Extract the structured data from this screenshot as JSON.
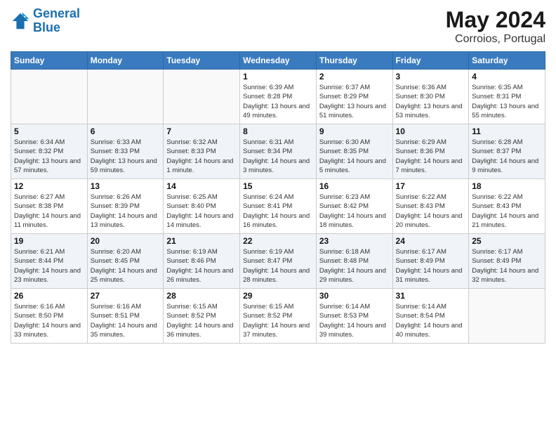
{
  "header": {
    "logo_general": "General",
    "logo_blue": "Blue",
    "title": "May 2024",
    "subtitle": "Corroios, Portugal"
  },
  "days_of_week": [
    "Sunday",
    "Monday",
    "Tuesday",
    "Wednesday",
    "Thursday",
    "Friday",
    "Saturday"
  ],
  "weeks": [
    [
      {
        "day": "",
        "sunrise": "",
        "sunset": "",
        "daylight": ""
      },
      {
        "day": "",
        "sunrise": "",
        "sunset": "",
        "daylight": ""
      },
      {
        "day": "",
        "sunrise": "",
        "sunset": "",
        "daylight": ""
      },
      {
        "day": "1",
        "sunrise": "Sunrise: 6:39 AM",
        "sunset": "Sunset: 8:28 PM",
        "daylight": "Daylight: 13 hours and 49 minutes."
      },
      {
        "day": "2",
        "sunrise": "Sunrise: 6:37 AM",
        "sunset": "Sunset: 8:29 PM",
        "daylight": "Daylight: 13 hours and 51 minutes."
      },
      {
        "day": "3",
        "sunrise": "Sunrise: 6:36 AM",
        "sunset": "Sunset: 8:30 PM",
        "daylight": "Daylight: 13 hours and 53 minutes."
      },
      {
        "day": "4",
        "sunrise": "Sunrise: 6:35 AM",
        "sunset": "Sunset: 8:31 PM",
        "daylight": "Daylight: 13 hours and 55 minutes."
      }
    ],
    [
      {
        "day": "5",
        "sunrise": "Sunrise: 6:34 AM",
        "sunset": "Sunset: 8:32 PM",
        "daylight": "Daylight: 13 hours and 57 minutes."
      },
      {
        "day": "6",
        "sunrise": "Sunrise: 6:33 AM",
        "sunset": "Sunset: 8:33 PM",
        "daylight": "Daylight: 13 hours and 59 minutes."
      },
      {
        "day": "7",
        "sunrise": "Sunrise: 6:32 AM",
        "sunset": "Sunset: 8:33 PM",
        "daylight": "Daylight: 14 hours and 1 minute."
      },
      {
        "day": "8",
        "sunrise": "Sunrise: 6:31 AM",
        "sunset": "Sunset: 8:34 PM",
        "daylight": "Daylight: 14 hours and 3 minutes."
      },
      {
        "day": "9",
        "sunrise": "Sunrise: 6:30 AM",
        "sunset": "Sunset: 8:35 PM",
        "daylight": "Daylight: 14 hours and 5 minutes."
      },
      {
        "day": "10",
        "sunrise": "Sunrise: 6:29 AM",
        "sunset": "Sunset: 8:36 PM",
        "daylight": "Daylight: 14 hours and 7 minutes."
      },
      {
        "day": "11",
        "sunrise": "Sunrise: 6:28 AM",
        "sunset": "Sunset: 8:37 PM",
        "daylight": "Daylight: 14 hours and 9 minutes."
      }
    ],
    [
      {
        "day": "12",
        "sunrise": "Sunrise: 6:27 AM",
        "sunset": "Sunset: 8:38 PM",
        "daylight": "Daylight: 14 hours and 11 minutes."
      },
      {
        "day": "13",
        "sunrise": "Sunrise: 6:26 AM",
        "sunset": "Sunset: 8:39 PM",
        "daylight": "Daylight: 14 hours and 13 minutes."
      },
      {
        "day": "14",
        "sunrise": "Sunrise: 6:25 AM",
        "sunset": "Sunset: 8:40 PM",
        "daylight": "Daylight: 14 hours and 14 minutes."
      },
      {
        "day": "15",
        "sunrise": "Sunrise: 6:24 AM",
        "sunset": "Sunset: 8:41 PM",
        "daylight": "Daylight: 14 hours and 16 minutes."
      },
      {
        "day": "16",
        "sunrise": "Sunrise: 6:23 AM",
        "sunset": "Sunset: 8:42 PM",
        "daylight": "Daylight: 14 hours and 18 minutes."
      },
      {
        "day": "17",
        "sunrise": "Sunrise: 6:22 AM",
        "sunset": "Sunset: 8:43 PM",
        "daylight": "Daylight: 14 hours and 20 minutes."
      },
      {
        "day": "18",
        "sunrise": "Sunrise: 6:22 AM",
        "sunset": "Sunset: 8:43 PM",
        "daylight": "Daylight: 14 hours and 21 minutes."
      }
    ],
    [
      {
        "day": "19",
        "sunrise": "Sunrise: 6:21 AM",
        "sunset": "Sunset: 8:44 PM",
        "daylight": "Daylight: 14 hours and 23 minutes."
      },
      {
        "day": "20",
        "sunrise": "Sunrise: 6:20 AM",
        "sunset": "Sunset: 8:45 PM",
        "daylight": "Daylight: 14 hours and 25 minutes."
      },
      {
        "day": "21",
        "sunrise": "Sunrise: 6:19 AM",
        "sunset": "Sunset: 8:46 PM",
        "daylight": "Daylight: 14 hours and 26 minutes."
      },
      {
        "day": "22",
        "sunrise": "Sunrise: 6:19 AM",
        "sunset": "Sunset: 8:47 PM",
        "daylight": "Daylight: 14 hours and 28 minutes."
      },
      {
        "day": "23",
        "sunrise": "Sunrise: 6:18 AM",
        "sunset": "Sunset: 8:48 PM",
        "daylight": "Daylight: 14 hours and 29 minutes."
      },
      {
        "day": "24",
        "sunrise": "Sunrise: 6:17 AM",
        "sunset": "Sunset: 8:49 PM",
        "daylight": "Daylight: 14 hours and 31 minutes."
      },
      {
        "day": "25",
        "sunrise": "Sunrise: 6:17 AM",
        "sunset": "Sunset: 8:49 PM",
        "daylight": "Daylight: 14 hours and 32 minutes."
      }
    ],
    [
      {
        "day": "26",
        "sunrise": "Sunrise: 6:16 AM",
        "sunset": "Sunset: 8:50 PM",
        "daylight": "Daylight: 14 hours and 33 minutes."
      },
      {
        "day": "27",
        "sunrise": "Sunrise: 6:16 AM",
        "sunset": "Sunset: 8:51 PM",
        "daylight": "Daylight: 14 hours and 35 minutes."
      },
      {
        "day": "28",
        "sunrise": "Sunrise: 6:15 AM",
        "sunset": "Sunset: 8:52 PM",
        "daylight": "Daylight: 14 hours and 36 minutes."
      },
      {
        "day": "29",
        "sunrise": "Sunrise: 6:15 AM",
        "sunset": "Sunset: 8:52 PM",
        "daylight": "Daylight: 14 hours and 37 minutes."
      },
      {
        "day": "30",
        "sunrise": "Sunrise: 6:14 AM",
        "sunset": "Sunset: 8:53 PM",
        "daylight": "Daylight: 14 hours and 39 minutes."
      },
      {
        "day": "31",
        "sunrise": "Sunrise: 6:14 AM",
        "sunset": "Sunset: 8:54 PM",
        "daylight": "Daylight: 14 hours and 40 minutes."
      },
      {
        "day": "",
        "sunrise": "",
        "sunset": "",
        "daylight": ""
      }
    ]
  ]
}
